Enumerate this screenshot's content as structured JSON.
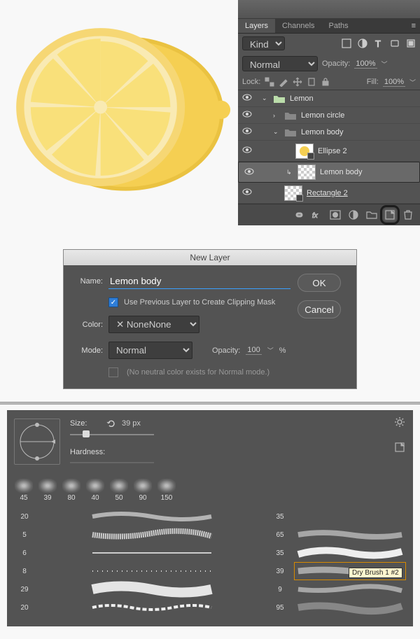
{
  "layers_panel": {
    "tabs": [
      "Layers",
      "Channels",
      "Paths"
    ],
    "active_tab": 0,
    "kind_label": "Kind",
    "blend_mode": "Normal",
    "opacity_label": "Opacity:",
    "opacity_value": "100%",
    "lock_label": "Lock:",
    "fill_label": "Fill:",
    "fill_value": "100%",
    "tree": [
      {
        "name": "Lemon",
        "type": "group",
        "depth": 0,
        "open": true
      },
      {
        "name": "Lemon circle",
        "type": "group",
        "depth": 1,
        "open": false
      },
      {
        "name": "Lemon body",
        "type": "group",
        "depth": 1,
        "open": true
      },
      {
        "name": "Ellipse 2",
        "type": "shape",
        "depth": 2
      },
      {
        "name": "Lemon body",
        "type": "layer",
        "depth": 2,
        "selected": true
      },
      {
        "name": "Rectangle 2",
        "type": "shape",
        "depth": 1,
        "underline": true
      }
    ]
  },
  "new_layer_dialog": {
    "title": "New Layer",
    "name_label": "Name:",
    "name_value": "Lemon body",
    "clip_checked": true,
    "clip_label": "Use Previous Layer to Create Clipping Mask",
    "color_label": "Color:",
    "color_value": "None",
    "mode_label": "Mode:",
    "mode_value": "Normal",
    "opacity_label": "Opacity:",
    "opacity_value": "100",
    "opacity_unit": "%",
    "neutral_hint": "(No neutral color exists for Normal mode.)",
    "ok": "OK",
    "cancel": "Cancel"
  },
  "brush_panel": {
    "size_label": "Size:",
    "size_value": "39 px",
    "hardness_label": "Hardness:",
    "tips": [
      {
        "size": "45"
      },
      {
        "size": "39"
      },
      {
        "size": "80"
      },
      {
        "size": "40"
      },
      {
        "size": "50"
      },
      {
        "size": "90"
      },
      {
        "size": "150"
      }
    ],
    "left_sizes": [
      "20",
      "+",
      "5",
      "+",
      "6",
      "+",
      "8",
      "",
      "29",
      "+",
      "20"
    ],
    "tip_col": [
      "35",
      "",
      "65",
      "",
      "35",
      "",
      "39",
      "",
      "9",
      "",
      "95"
    ],
    "tooltip": "Dry Brush 1 #2"
  }
}
